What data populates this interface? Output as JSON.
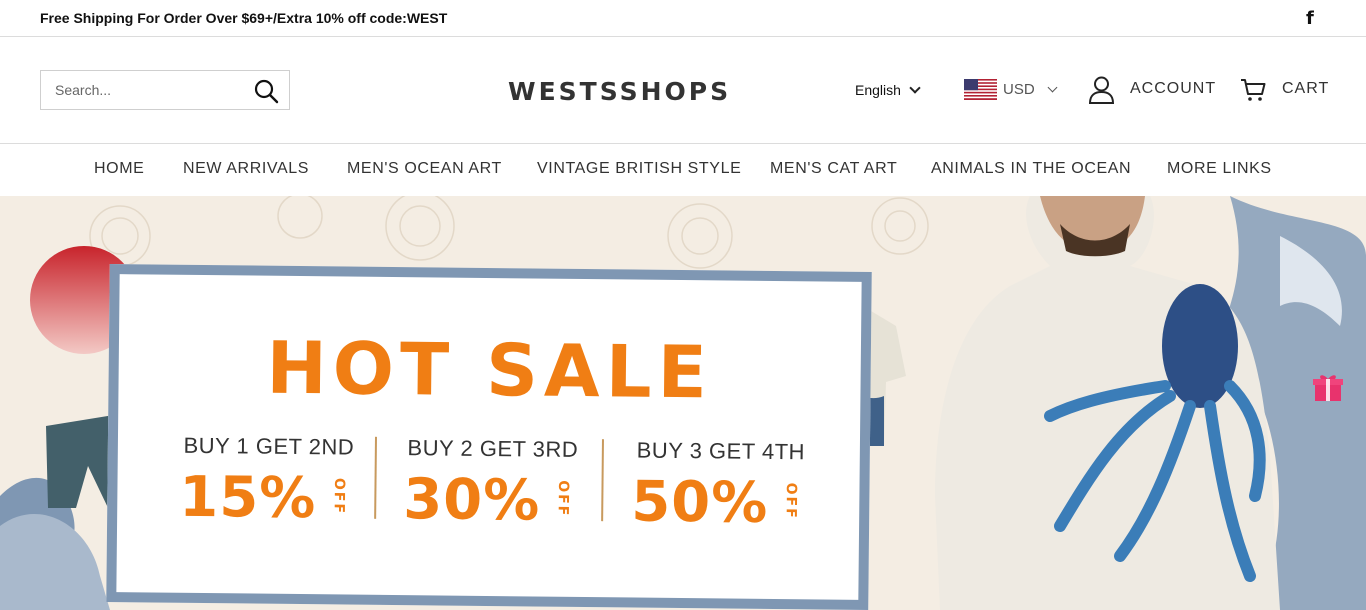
{
  "announcement": {
    "text": "Free Shipping For Order Over $69+/Extra 10% off code:WEST",
    "social_icon": "f"
  },
  "header": {
    "search_placeholder": "Search...",
    "logo": "WESTSSHOPS",
    "language": "English",
    "currency": "USD",
    "account_label": "ACCOUNT",
    "cart_label": "CART"
  },
  "nav": {
    "items": [
      {
        "label": "HOME"
      },
      {
        "label": "NEW ARRIVALS"
      },
      {
        "label": "MEN'S OCEAN ART"
      },
      {
        "label": "VINTAGE BRITISH STYLE"
      },
      {
        "label": "MEN'S CAT ART"
      },
      {
        "label": "ANIMALS IN THE OCEAN"
      },
      {
        "label": "MORE LINKS"
      }
    ]
  },
  "banner": {
    "headline": "HOT SALE",
    "offers": [
      {
        "head": "BUY 1 GET 2ND",
        "percent": "15%",
        "off": "OFF"
      },
      {
        "head": "BUY 2 GET 3RD",
        "percent": "30%",
        "off": "OFF"
      },
      {
        "head": "BUY 3 GET 4TH",
        "percent": "50%",
        "off": "OFF"
      }
    ]
  },
  "colors": {
    "accent_orange": "#f07e14",
    "frame_blue": "#7f97b3",
    "sun_red": "#c8242c"
  }
}
